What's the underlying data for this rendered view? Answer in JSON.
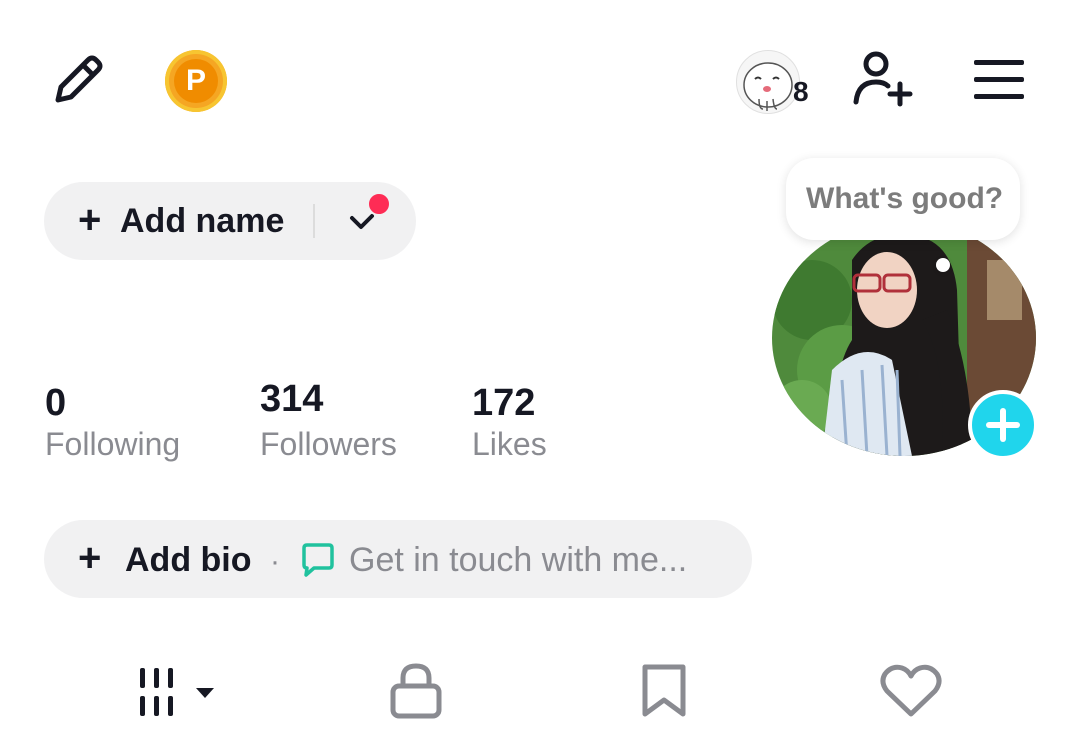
{
  "header": {
    "points_badge_letter": "P",
    "friend_count": "8",
    "icons": [
      "edit-icon",
      "points-badge",
      "friend-avatar",
      "add-friend-icon",
      "menu-icon"
    ]
  },
  "profile": {
    "add_name_label": "Add name",
    "bubble_text": "What's good?",
    "notification_dot_color": "#fe2c55",
    "add_photo_color": "#20d5ec"
  },
  "stats": {
    "following": {
      "value": "0",
      "label": "Following"
    },
    "followers": {
      "value": "314",
      "label": "Followers"
    },
    "likes": {
      "value": "172",
      "label": "Likes"
    }
  },
  "bio": {
    "add_bio_label": "Add bio",
    "separator": "·",
    "contact_text": "Get in touch with me..."
  },
  "tabs": [
    "grid-icon",
    "lock-icon",
    "bookmark-icon",
    "heart-icon"
  ]
}
